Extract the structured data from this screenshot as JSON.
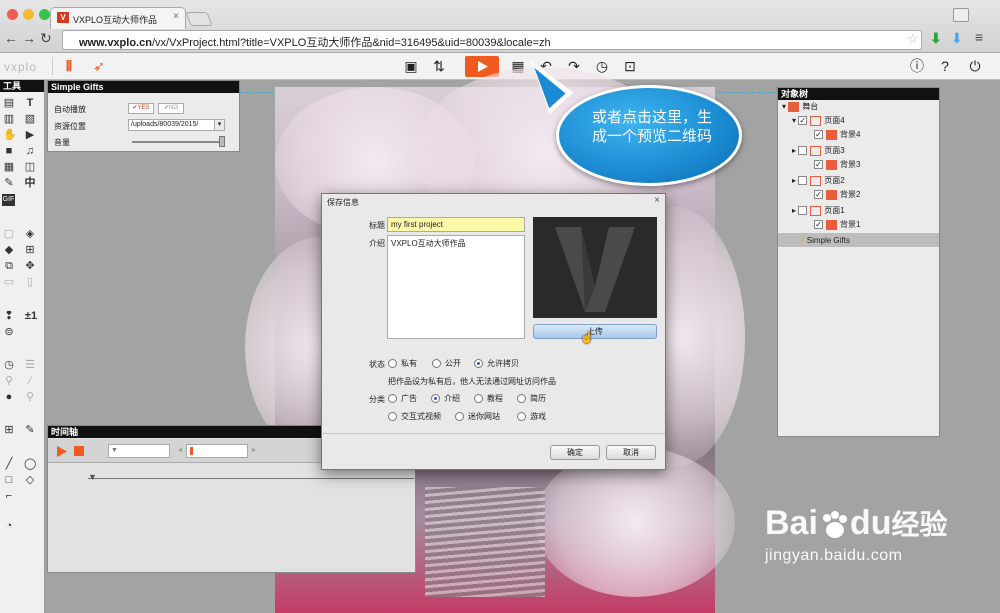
{
  "browser": {
    "tab_title": "VXPLO互动大师作品",
    "tab_close": "×",
    "url_host": "www.vxplo.cn",
    "url_path": "/vx/VxProject.html?title=VXPLO互动大师作品&nid=316495&uid=80039&locale=zh"
  },
  "app": {
    "logo": "vxplo"
  },
  "tools_panel": {
    "title": "工具",
    "labels": [
      "T",
      "中",
      "±1",
      "GIF"
    ]
  },
  "props_panel": {
    "title": "Simple Gifts",
    "autoplay_label": "自动播放",
    "yes": "YES",
    "no": "NO",
    "resource_label": "资源位置",
    "resource_value": "/uploads/80039/2015/",
    "volume_label": "音量"
  },
  "object_tree": {
    "title": "对象树",
    "root": "舞台",
    "pages": [
      {
        "page": "页面4",
        "bg": "背景4"
      },
      {
        "page": "页面3",
        "bg": "背景3"
      },
      {
        "page": "页面2",
        "bg": "背景2"
      },
      {
        "page": "页面1",
        "bg": "背景1"
      }
    ],
    "audio": "Simple Gifts"
  },
  "timeline": {
    "title": "时间轴"
  },
  "dialog": {
    "title": "保存信息",
    "title_label": "标题",
    "title_value": "my first project",
    "intro_label": "介绍",
    "intro_value": "VXPLO互动大师作品",
    "upload_button": "上传",
    "status_label": "状态",
    "status_options": [
      "私有",
      "公开",
      "允许拷贝"
    ],
    "status_selected": 2,
    "status_note": "把作品设为私有后，他人无法通过网址访问作品",
    "category_label": "分类",
    "category_options": [
      "广告",
      "介绍",
      "教程",
      "简历",
      "交互式视频",
      "迷你网站",
      "游戏"
    ],
    "category_selected": 1,
    "ok_button": "确定",
    "cancel_button": "取消"
  },
  "callout": {
    "text": "或者点击这里，生成一个预览二维码"
  },
  "watermark": {
    "brand": "Bai",
    "brand2": "du",
    "suffix": "经验",
    "url": "jingyan.baidu.com"
  },
  "colors": {
    "accent": "#f05a1e",
    "selection": "#2a62c9",
    "callout": "#1a8ad2"
  }
}
